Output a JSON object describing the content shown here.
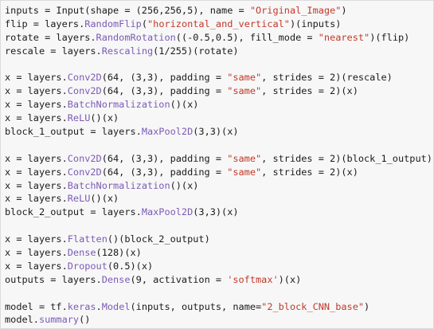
{
  "editor": {
    "lines": [
      [
        {
          "t": "inputs = Input(shape = (256,256,5), name = ",
          "c": "plain"
        },
        {
          "t": "\"Original_Image\"",
          "c": "str"
        },
        {
          "t": ")",
          "c": "plain"
        }
      ],
      [
        {
          "t": "flip = layers.",
          "c": "plain"
        },
        {
          "t": "RandomFlip",
          "c": "fn"
        },
        {
          "t": "(",
          "c": "plain"
        },
        {
          "t": "\"horizontal_and_vertical\"",
          "c": "str"
        },
        {
          "t": ")(inputs)",
          "c": "plain"
        }
      ],
      [
        {
          "t": "rotate = layers.",
          "c": "plain"
        },
        {
          "t": "RandomRotation",
          "c": "fn"
        },
        {
          "t": "((-0.5,0.5), fill_mode = ",
          "c": "plain"
        },
        {
          "t": "\"nearest\"",
          "c": "str"
        },
        {
          "t": ")(flip)",
          "c": "plain"
        }
      ],
      [
        {
          "t": "rescale = layers.",
          "c": "plain"
        },
        {
          "t": "Rescaling",
          "c": "fn"
        },
        {
          "t": "(1/255)(rotate)",
          "c": "plain"
        }
      ],
      [],
      [
        {
          "t": "x = layers.",
          "c": "plain"
        },
        {
          "t": "Conv2D",
          "c": "fn"
        },
        {
          "t": "(64, (3,3), padding = ",
          "c": "plain"
        },
        {
          "t": "\"same\"",
          "c": "str"
        },
        {
          "t": ", strides = 2)(rescale)",
          "c": "plain"
        }
      ],
      [
        {
          "t": "x = layers.",
          "c": "plain"
        },
        {
          "t": "Conv2D",
          "c": "fn"
        },
        {
          "t": "(64, (3,3), padding = ",
          "c": "plain"
        },
        {
          "t": "\"same\"",
          "c": "str"
        },
        {
          "t": ", strides = 2)(x)",
          "c": "plain"
        }
      ],
      [
        {
          "t": "x = layers.",
          "c": "plain"
        },
        {
          "t": "BatchNormalization",
          "c": "fn"
        },
        {
          "t": "()(x)",
          "c": "plain"
        }
      ],
      [
        {
          "t": "x = layers.",
          "c": "plain"
        },
        {
          "t": "ReLU",
          "c": "fn"
        },
        {
          "t": "()(x)",
          "c": "plain"
        }
      ],
      [
        {
          "t": "block_1_output = layers.",
          "c": "plain"
        },
        {
          "t": "MaxPool2D",
          "c": "fn"
        },
        {
          "t": "(3,3)(x)",
          "c": "plain"
        }
      ],
      [],
      [
        {
          "t": "x = layers.",
          "c": "plain"
        },
        {
          "t": "Conv2D",
          "c": "fn"
        },
        {
          "t": "(64, (3,3), padding = ",
          "c": "plain"
        },
        {
          "t": "\"same\"",
          "c": "str"
        },
        {
          "t": ", strides = 2)(block_1_output)",
          "c": "plain"
        }
      ],
      [
        {
          "t": "x = layers.",
          "c": "plain"
        },
        {
          "t": "Conv2D",
          "c": "fn"
        },
        {
          "t": "(64, (3,3), padding = ",
          "c": "plain"
        },
        {
          "t": "\"same\"",
          "c": "str"
        },
        {
          "t": ", strides = 2)(x)",
          "c": "plain"
        }
      ],
      [
        {
          "t": "x = layers.",
          "c": "plain"
        },
        {
          "t": "BatchNormalization",
          "c": "fn"
        },
        {
          "t": "()(x)",
          "c": "plain"
        }
      ],
      [
        {
          "t": "x = layers.",
          "c": "plain"
        },
        {
          "t": "ReLU",
          "c": "fn"
        },
        {
          "t": "()(x)",
          "c": "plain"
        }
      ],
      [
        {
          "t": "block_2_output = layers.",
          "c": "plain"
        },
        {
          "t": "MaxPool2D",
          "c": "fn"
        },
        {
          "t": "(3,3)(x)",
          "c": "plain"
        }
      ],
      [],
      [
        {
          "t": "x = layers.",
          "c": "plain"
        },
        {
          "t": "Flatten",
          "c": "fn"
        },
        {
          "t": "()(block_2_output)",
          "c": "plain"
        }
      ],
      [
        {
          "t": "x = layers.",
          "c": "plain"
        },
        {
          "t": "Dense",
          "c": "fn"
        },
        {
          "t": "(128)(x)",
          "c": "plain"
        }
      ],
      [
        {
          "t": "x = layers.",
          "c": "plain"
        },
        {
          "t": "Dropout",
          "c": "fn"
        },
        {
          "t": "(0.5)(x)",
          "c": "plain"
        }
      ],
      [
        {
          "t": "outputs = layers.",
          "c": "plain"
        },
        {
          "t": "Dense",
          "c": "fn"
        },
        {
          "t": "(9, activation = ",
          "c": "plain"
        },
        {
          "t": "'softmax'",
          "c": "str"
        },
        {
          "t": ")(x)",
          "c": "plain"
        }
      ],
      [],
      [
        {
          "t": "model = tf.",
          "c": "plain"
        },
        {
          "t": "keras",
          "c": "fn"
        },
        {
          "t": ".",
          "c": "plain"
        },
        {
          "t": "Model",
          "c": "fn"
        },
        {
          "t": "(inputs, outputs, name=",
          "c": "plain"
        },
        {
          "t": "\"2_block_CNN_base\"",
          "c": "str"
        },
        {
          "t": ")",
          "c": "plain"
        }
      ],
      [
        {
          "t": "model.",
          "c": "plain"
        },
        {
          "t": "summary",
          "c": "fn"
        },
        {
          "t": "()",
          "c": "plain"
        }
      ]
    ]
  },
  "colors": {
    "background": "#f7f7f7",
    "function": "#7c5bb5",
    "string": "#c0392b",
    "text": "#1a1a1a"
  }
}
